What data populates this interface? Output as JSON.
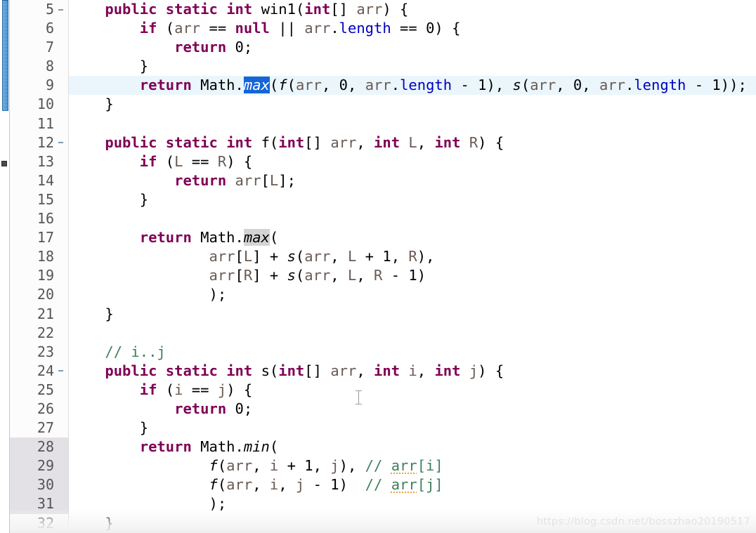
{
  "editor": {
    "language": "java",
    "first_visible_line": 5,
    "last_visible_line": 32,
    "current_line": 9,
    "selected_token": "max",
    "theme_colors": {
      "keyword": "#7f0055",
      "field": "#0000c0",
      "parameter": "#6a5a53",
      "comment": "#3f7f5f",
      "selection_bg": "#1565d8",
      "occurrence_bg": "#d4d4d4",
      "current_line_bg": "#eaf6fb",
      "gutter_mark_bg": "#e4e1e6",
      "scrollbar_thumb": "#3d8dd1"
    }
  },
  "gutter": {
    "lines": [
      {
        "n": "5",
        "fold": true,
        "mark": false
      },
      {
        "n": "6",
        "fold": false,
        "mark": false
      },
      {
        "n": "7",
        "fold": false,
        "mark": false
      },
      {
        "n": "8",
        "fold": false,
        "mark": false
      },
      {
        "n": "9",
        "fold": false,
        "mark": false
      },
      {
        "n": "10",
        "fold": false,
        "mark": false
      },
      {
        "n": "11",
        "fold": false,
        "mark": false
      },
      {
        "n": "12",
        "fold": true,
        "mark": false
      },
      {
        "n": "13",
        "fold": false,
        "mark": false
      },
      {
        "n": "14",
        "fold": false,
        "mark": false
      },
      {
        "n": "15",
        "fold": false,
        "mark": false
      },
      {
        "n": "16",
        "fold": false,
        "mark": false
      },
      {
        "n": "17",
        "fold": false,
        "mark": false
      },
      {
        "n": "18",
        "fold": false,
        "mark": false
      },
      {
        "n": "19",
        "fold": false,
        "mark": false
      },
      {
        "n": "20",
        "fold": false,
        "mark": false
      },
      {
        "n": "21",
        "fold": false,
        "mark": false
      },
      {
        "n": "22",
        "fold": false,
        "mark": false
      },
      {
        "n": "23",
        "fold": false,
        "mark": false
      },
      {
        "n": "24",
        "fold": true,
        "mark": false
      },
      {
        "n": "25",
        "fold": false,
        "mark": false
      },
      {
        "n": "26",
        "fold": false,
        "mark": false
      },
      {
        "n": "27",
        "fold": false,
        "mark": false
      },
      {
        "n": "28",
        "fold": false,
        "mark": true
      },
      {
        "n": "29",
        "fold": false,
        "mark": true
      },
      {
        "n": "30",
        "fold": false,
        "mark": true
      },
      {
        "n": "31",
        "fold": false,
        "mark": true
      },
      {
        "n": "32",
        "fold": false,
        "mark": false
      }
    ]
  },
  "code": {
    "line_5": "    public static int win1(int[] arr) {",
    "line_6": "        if (arr == null || arr.length == 0) {",
    "line_7": "            return 0;",
    "line_8": "        }",
    "line_9": "        return Math.max(f(arr, 0, arr.length - 1), s(arr, 0, arr.length - 1));",
    "line_10": "    }",
    "line_11": "",
    "line_12": "    public static int f(int[] arr, int L, int R) {",
    "line_13": "        if (L == R) {",
    "line_14": "            return arr[L];",
    "line_15": "        }",
    "line_16": "",
    "line_17": "        return Math.max(",
    "line_18": "                arr[L] + s(arr, L + 1, R),",
    "line_19": "                arr[R] + s(arr, L, R - 1)",
    "line_20": "                );",
    "line_21": "    }",
    "line_22": "",
    "line_23": "    // i..j",
    "line_24": "    public static int s(int[] arr, int i, int j) {",
    "line_25": "        if (i == j) {",
    "line_26": "            return 0;",
    "line_27": "        }",
    "line_28": "        return Math.min(",
    "line_29": "                f(arr, i + 1, j), // arr[i]",
    "line_30": "                f(arr, i, j - 1)  // arr[j]",
    "line_31": "                );",
    "line_32": "    }"
  },
  "tokens": {
    "kw_public": "public",
    "kw_static": "static",
    "kw_int": "int",
    "kw_if": "if",
    "kw_null": "null",
    "kw_return": "return",
    "id_win1": "win1",
    "id_f": "f",
    "id_s": "s",
    "id_arr": "arr",
    "id_length": "length",
    "id_Math": "Math",
    "id_max": "max",
    "id_min": "min",
    "id_L": "L",
    "id_R": "R",
    "id_i": "i",
    "id_j": "j",
    "comment_ij": "// i..j",
    "comment_arr_i": "// arr[i]",
    "comment_arr_j": "// arr[j]"
  },
  "watermark": {
    "text": "https://blog.csdn.net/bosszhao20190517"
  }
}
